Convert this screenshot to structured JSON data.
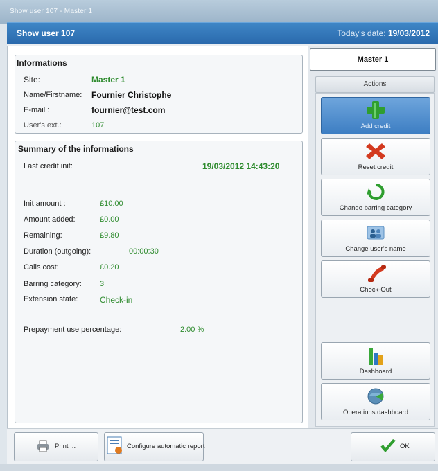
{
  "window": {
    "title": "Show user 107 - Master 1"
  },
  "header": {
    "title": "Show user 107",
    "date_label": "Today's date:",
    "date_value": "19/03/2012"
  },
  "informations": {
    "title": "Informations",
    "site_label": "Site:",
    "site_value": "Master 1",
    "name_label": "Name/Firstname:",
    "name_value": "Fournier Christophe",
    "email_label": "E-mail :",
    "email_value": "fournier@test.com",
    "ext_label": "User's ext.:",
    "ext_value": "107"
  },
  "summary": {
    "title": "Summary of the informations",
    "last_credit_label": "Last credit init:",
    "last_credit_value": "19/03/2012 14:43:20",
    "init_amount_label": "Init amount :",
    "init_amount_value": "£10.00",
    "amount_added_label": "Amount added:",
    "amount_added_value": "£0.00",
    "remaining_label": "Remaining:",
    "remaining_value": "£9.80",
    "duration_label": "Duration (outgoing):",
    "duration_value": "00:00:30",
    "calls_cost_label": "Calls cost:",
    "calls_cost_value": "£0.20",
    "barring_label": "Barring category:",
    "barring_value": "3",
    "extension_label": "Extension state:",
    "extension_value": "Check-in",
    "prepayment_label": "Prepayment use percentage:",
    "prepayment_value": "2.00 %"
  },
  "right_panel": {
    "site_name": "Master 1",
    "actions_title": "Actions",
    "buttons": {
      "add_credit": "Add credit",
      "reset_credit": "Reset credit",
      "change_barring": "Change barring category",
      "change_name": "Change user's name",
      "checkout": "Check-Out",
      "dashboard": "Dashboard",
      "ops_dashboard": "Operations dashboard"
    }
  },
  "footer": {
    "print_label": "Print ...",
    "report_label": "Configure automatic report",
    "ok_label": "OK"
  },
  "icons": {
    "add_credit": "plus-icon",
    "reset_credit": "cross-icon",
    "change_barring": "refresh-icon",
    "change_name": "users-icon",
    "checkout": "phone-icon",
    "dashboard": "bar-chart-icon",
    "ops_dashboard": "globe-icon",
    "print": "printer-icon",
    "report": "report-icon",
    "ok": "checkmark-icon"
  },
  "colors": {
    "header_blue": "#2a6aad",
    "value_green": "#2e8b2e",
    "active_button": "#3d7ec3"
  }
}
